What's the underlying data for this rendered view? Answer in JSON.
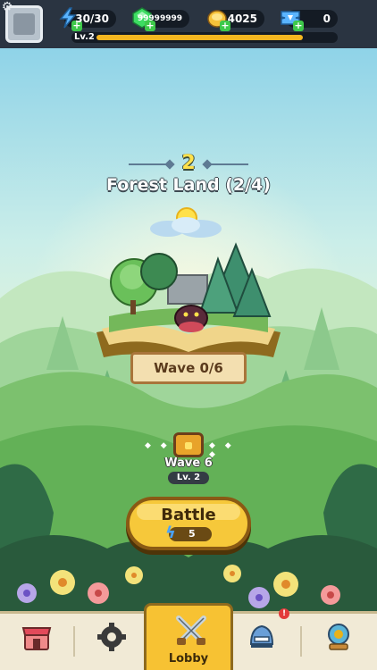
{
  "topbar": {
    "energy": "30/30",
    "gems": "99999999",
    "gold": "4025",
    "tickets": "0",
    "level_label": "Lv.2",
    "xp_progress": 0.87
  },
  "stage": {
    "number": "2",
    "name": "Forest Land (2/4)",
    "wave_label": "Wave 0/6"
  },
  "reward": {
    "title": "Wave 6",
    "level": "Lv. 2",
    "dots_left": "◆ ◆ ◆",
    "dots_right": "◆ ◆ ◆"
  },
  "battle": {
    "label": "Battle",
    "cost": "5"
  },
  "nav": {
    "shop": "shop-icon",
    "settings": "gear-icon",
    "lobby_label": "Lobby",
    "heroes": "helmet-icon",
    "heroes_badge": "!",
    "dungeon": "portal-icon"
  },
  "colors": {
    "accent_yellow": "#f6c83a",
    "topbar": "#2a3441",
    "nav_bg": "#f1ead6"
  }
}
